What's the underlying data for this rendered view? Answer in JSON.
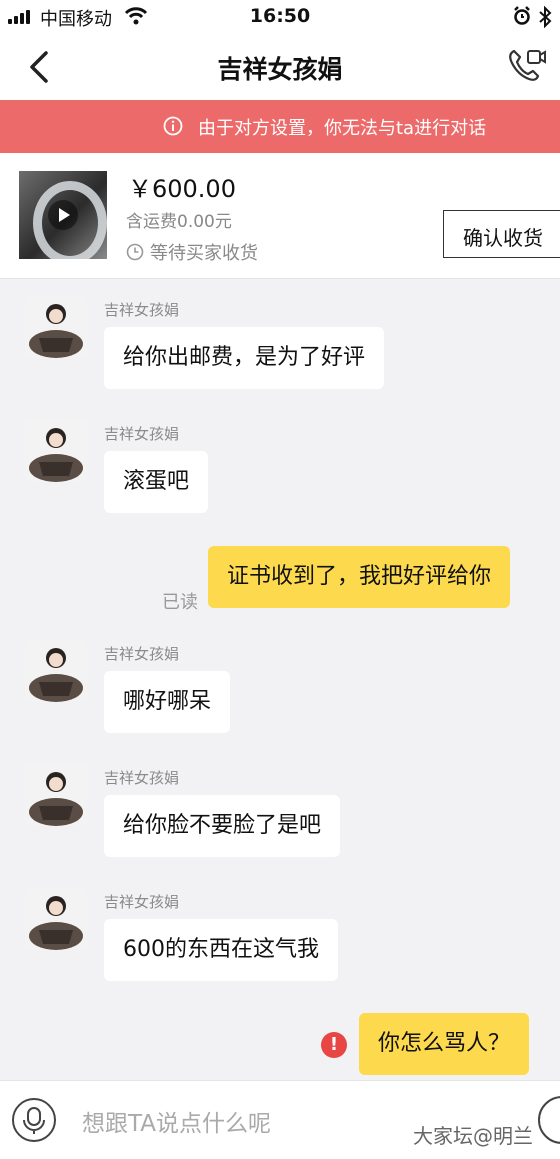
{
  "status_bar": {
    "carrier": "中国移动",
    "time": "16:50"
  },
  "header": {
    "title": "吉祥女孩娟",
    "back_icon": "chevron-left-icon",
    "call_icon": "phone-video-icon"
  },
  "banner": {
    "text": "由于对方设置，你无法与ta进行对话",
    "icon": "info-icon",
    "color": "#ed6a6a"
  },
  "order": {
    "price": "￥600.00",
    "shipping": "含运费0.00元",
    "status": "等待买家收货",
    "confirm_label": "确认收货"
  },
  "messages": [
    {
      "from": "other",
      "sender": "吉祥女孩娟",
      "text": "给你出邮费，是为了好评"
    },
    {
      "from": "other",
      "sender": "吉祥女孩娟",
      "text": "滚蛋吧"
    },
    {
      "from": "me",
      "text": "证书收到了，我把好评给你",
      "status": "已读"
    },
    {
      "from": "other",
      "sender": "吉祥女孩娟",
      "text": "哪好哪呆"
    },
    {
      "from": "other",
      "sender": "吉祥女孩娟",
      "text": "给你脸不要脸了是吧"
    },
    {
      "from": "other",
      "sender": "吉祥女孩娟",
      "text": "600的东西在这气我"
    },
    {
      "from": "me",
      "text": "你怎么骂人？",
      "error": "!"
    }
  ],
  "input": {
    "placeholder": "想跟TA说点什么呢"
  },
  "watermark": "大家坛@明兰",
  "colors": {
    "bubble_out": "#fdd94d",
    "background": "#f2f2f4"
  }
}
